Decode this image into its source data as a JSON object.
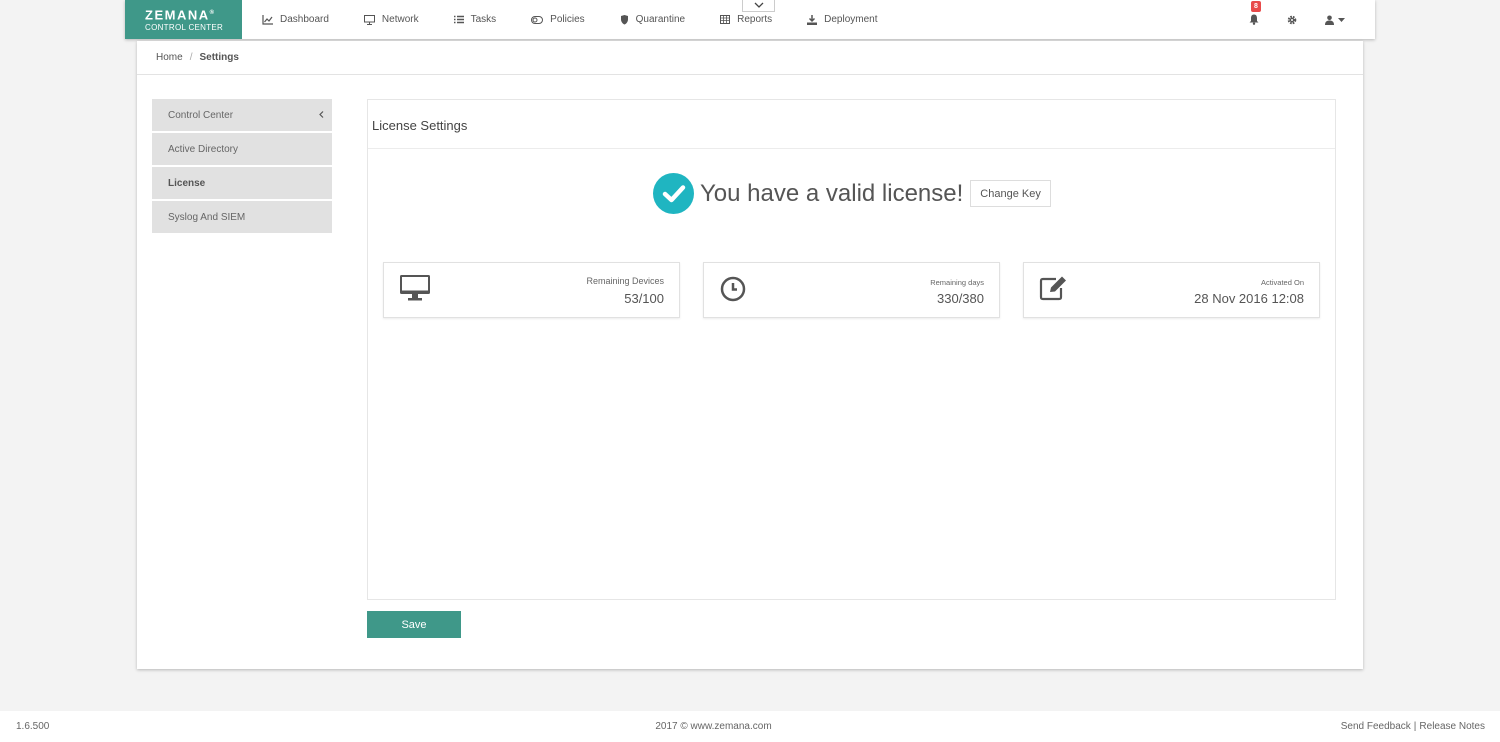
{
  "brand": {
    "name": "ZEMANA",
    "reg": "®",
    "subtitle": "CONTROL CENTER",
    "color": "#3f9889"
  },
  "nav": [
    {
      "label": "Dashboard",
      "icon": "chart-line-icon"
    },
    {
      "label": "Network",
      "icon": "monitor-icon"
    },
    {
      "label": "Tasks",
      "icon": "list-icon"
    },
    {
      "label": "Policies",
      "icon": "toggle-icon"
    },
    {
      "label": "Quarantine",
      "icon": "shield-icon"
    },
    {
      "label": "Reports",
      "icon": "table-icon"
    },
    {
      "label": "Deployment",
      "icon": "download-icon"
    }
  ],
  "notifications": {
    "count": "8",
    "badge_color": "#e84a4a"
  },
  "breadcrumb": {
    "home": "Home",
    "separator": "/",
    "current": "Settings"
  },
  "side_menu": [
    {
      "label": "Control Center",
      "active": false
    },
    {
      "label": "Active Directory",
      "active": false
    },
    {
      "label": "License",
      "active": true
    },
    {
      "label": "Syslog And SIEM",
      "active": false
    }
  ],
  "license": {
    "title": "License Settings",
    "status_text": "You have a valid license!",
    "change_key_label": "Change Key",
    "check_color": "#1fb5c1",
    "cards": [
      {
        "label": "Remaining Devices",
        "value": "53/100",
        "icon": "monitor-icon"
      },
      {
        "label": "Remaining days",
        "value": "330/380",
        "icon": "clock-icon"
      },
      {
        "label": "Activated On",
        "value": "28 Nov 2016 12:08",
        "icon": "edit-icon"
      }
    ]
  },
  "save_label": "Save",
  "footer": {
    "version": "1.6.500",
    "copyright": "2017 © www.zemana.com",
    "feedback": "Send Feedback",
    "separator": "|",
    "release_notes": "Release Notes"
  }
}
